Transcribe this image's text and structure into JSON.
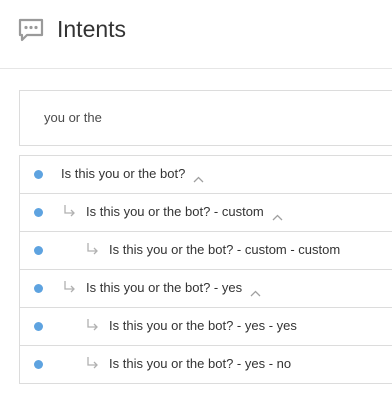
{
  "header": {
    "title": "Intents",
    "icon": "chat-bubble-icon"
  },
  "search": {
    "value": "you or the"
  },
  "colors": {
    "dot": "#5ea3e0",
    "text": "#333333",
    "muted": "#b0b0b0",
    "border": "#dcdcdc"
  },
  "intents": [
    {
      "label": "Is this you or the bot?",
      "depth": 0,
      "expandable": true
    },
    {
      "label": "Is this you or the bot? - custom",
      "depth": 1,
      "expandable": true
    },
    {
      "label": "Is this you or the bot? - custom - custom",
      "depth": 2,
      "expandable": false
    },
    {
      "label": "Is this you or the bot? - yes",
      "depth": 1,
      "expandable": true
    },
    {
      "label": "Is this you or the bot? - yes - yes",
      "depth": 2,
      "expandable": false
    },
    {
      "label": "Is this you or the bot? - yes - no",
      "depth": 2,
      "expandable": false
    }
  ]
}
